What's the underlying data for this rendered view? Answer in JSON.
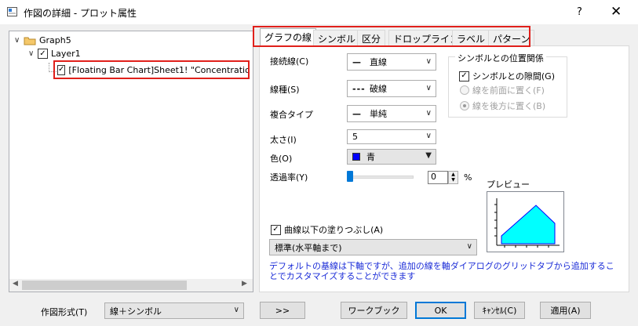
{
  "window": {
    "title": "作図の詳細 - プロット属性",
    "help": "?",
    "close": "✕"
  },
  "tree": {
    "graph": "Graph5",
    "layer": "Layer1",
    "plot": "[Floating Bar Chart]Sheet1! \"Concentration"
  },
  "tabs": [
    "グラフの線",
    "シンボル",
    "区分",
    "ドロップライン",
    "ラベル",
    "パターン"
  ],
  "line": {
    "connect_label": "接続線(C)",
    "connect_value": "直線",
    "style_label": "線種(S)",
    "style_value": "破線",
    "compound_label": "複合タイプ",
    "compound_value": "単純",
    "width_label": "太さ(I)",
    "width_value": "5",
    "color_label": "色(O)",
    "color_value": "青",
    "color_hex": "#0000ff",
    "transparency_label": "透過率(Y)",
    "transparency_value": "0",
    "percent": "%"
  },
  "symbol_group": {
    "title": "シンボルとの位置関係",
    "gap_label": "シンボルとの隙間(G)",
    "gap_checked": true,
    "front_label": "線を前面に置く(F)",
    "back_label": "線を後方に置く(B)"
  },
  "preview": {
    "label": "プレビュー"
  },
  "fill": {
    "checkbox_label": "曲線以下の塗りつぶし(A)",
    "checked": true,
    "mode_value": "標準(水平軸まで)"
  },
  "note": "デフォルトの基線は下軸ですが、追加の線を軸ダイアログのグリッドタブから追加することでカスタマイズすることができます",
  "bottom": {
    "plot_type_label": "作図形式(T)",
    "plot_type_value": "線＋シンボル",
    "expand": ">>",
    "workbook": "ワークブック",
    "ok": "OK",
    "cancel": "ｷｬﾝｾﾙ(C)",
    "apply": "適用(A)"
  }
}
